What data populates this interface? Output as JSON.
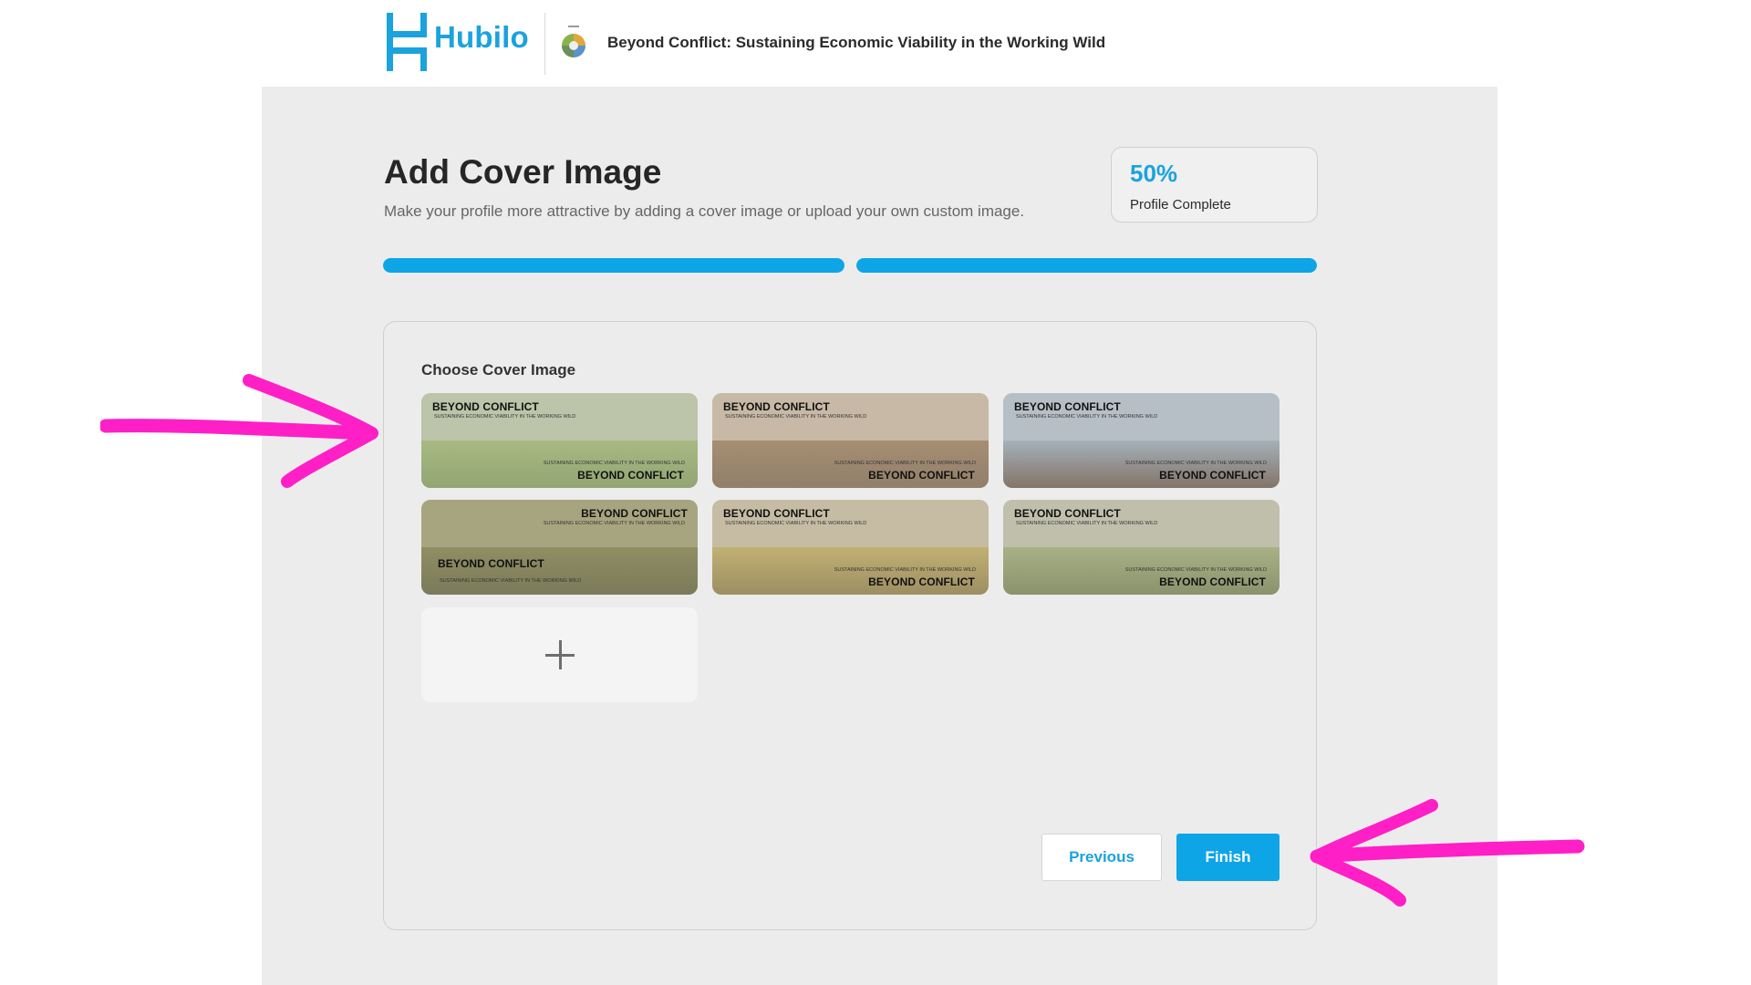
{
  "header": {
    "brand_name": "Hubilo",
    "event_title": "Beyond Conflict: Sustaining Economic Viability in the Working Wild",
    "brand_color": "#1aa3dd"
  },
  "page": {
    "title": "Add Cover Image",
    "subtitle": "Make your profile more attractive by adding a cover image or upload your own custom image."
  },
  "progress": {
    "percent_label": "50%",
    "label": "Profile Complete",
    "steps": [
      {
        "step": 1,
        "filled_fraction": 1.0
      },
      {
        "step": 2,
        "filled_fraction": 1.0
      }
    ],
    "accent_color": "#0ea5e6"
  },
  "cover_picker": {
    "section_title": "Choose Cover Image",
    "images": [
      {
        "id": "cover-1",
        "title_top": "BEYOND CONFLICT",
        "sub_top": "SUSTAINING ECONOMIC VIABILITY\nIN THE WORKING WILD",
        "sub_bottom": "SUSTAINING ECONOMIC VIABILITY\nIN THE WORKING WILD",
        "title_bottom": "BEYOND CONFLICT",
        "scene": "green meadow with grazing herd",
        "selected": true
      },
      {
        "id": "cover-2",
        "title_top": "BEYOND CONFLICT",
        "sub_top": "SUSTAINING ECONOMIC VIABILITY\nIN THE WORKING WILD",
        "sub_bottom": "SUSTAINING ECONOMIC VIABILITY\nIN THE WORKING WILD",
        "title_bottom": "BEYOND CONFLICT",
        "scene": "brown ranch with fence and mountains",
        "selected": false
      },
      {
        "id": "cover-3",
        "title_top": "BEYOND CONFLICT",
        "sub_top": "SUSTAINING ECONOMIC VIABILITY\nIN THE WORKING WILD",
        "sub_bottom": "SUSTAINING ECONOMIC VIABILITY\nIN THE WORKING WILD",
        "title_bottom": "BEYOND CONFLICT",
        "scene": "grizzly bear in grassland",
        "selected": false
      },
      {
        "id": "cover-4",
        "title_top": "BEYOND CONFLICT",
        "sub_top": "SUSTAINING ECONOMIC VIABILITY\nIN THE WORKING WILD",
        "sub_bottom": "SUSTAINING ECONOMIC VIABILITY\nIN THE WORKING WILD",
        "title_bottom": "BEYOND CONFLICT",
        "scene": "people walking on autumn hillside",
        "selected": false
      },
      {
        "id": "cover-5",
        "title_top": "BEYOND CONFLICT",
        "sub_top": "SUSTAINING ECONOMIC VIABILITY\nIN THE WORKING WILD",
        "sub_bottom": "SUSTAINING ECONOMIC VIABILITY\nIN THE WORKING WILD",
        "title_bottom": "BEYOND CONFLICT",
        "scene": "hay bales in golden field",
        "selected": false
      },
      {
        "id": "cover-6",
        "title_top": "BEYOND CONFLICT",
        "sub_top": "SUSTAINING ECONOMIC VIABILITY\nIN THE WORKING WILD",
        "sub_bottom": "SUSTAINING ECONOMIC VIABILITY\nIN THE WORKING WILD",
        "title_bottom": "BEYOND CONFLICT",
        "scene": "cattle by river with trees",
        "selected": false
      }
    ],
    "upload_icon": "plus-icon"
  },
  "actions": {
    "previous_label": "Previous",
    "finish_label": "Finish"
  },
  "annotations": {
    "arrow_color": "#ff1fc6"
  }
}
